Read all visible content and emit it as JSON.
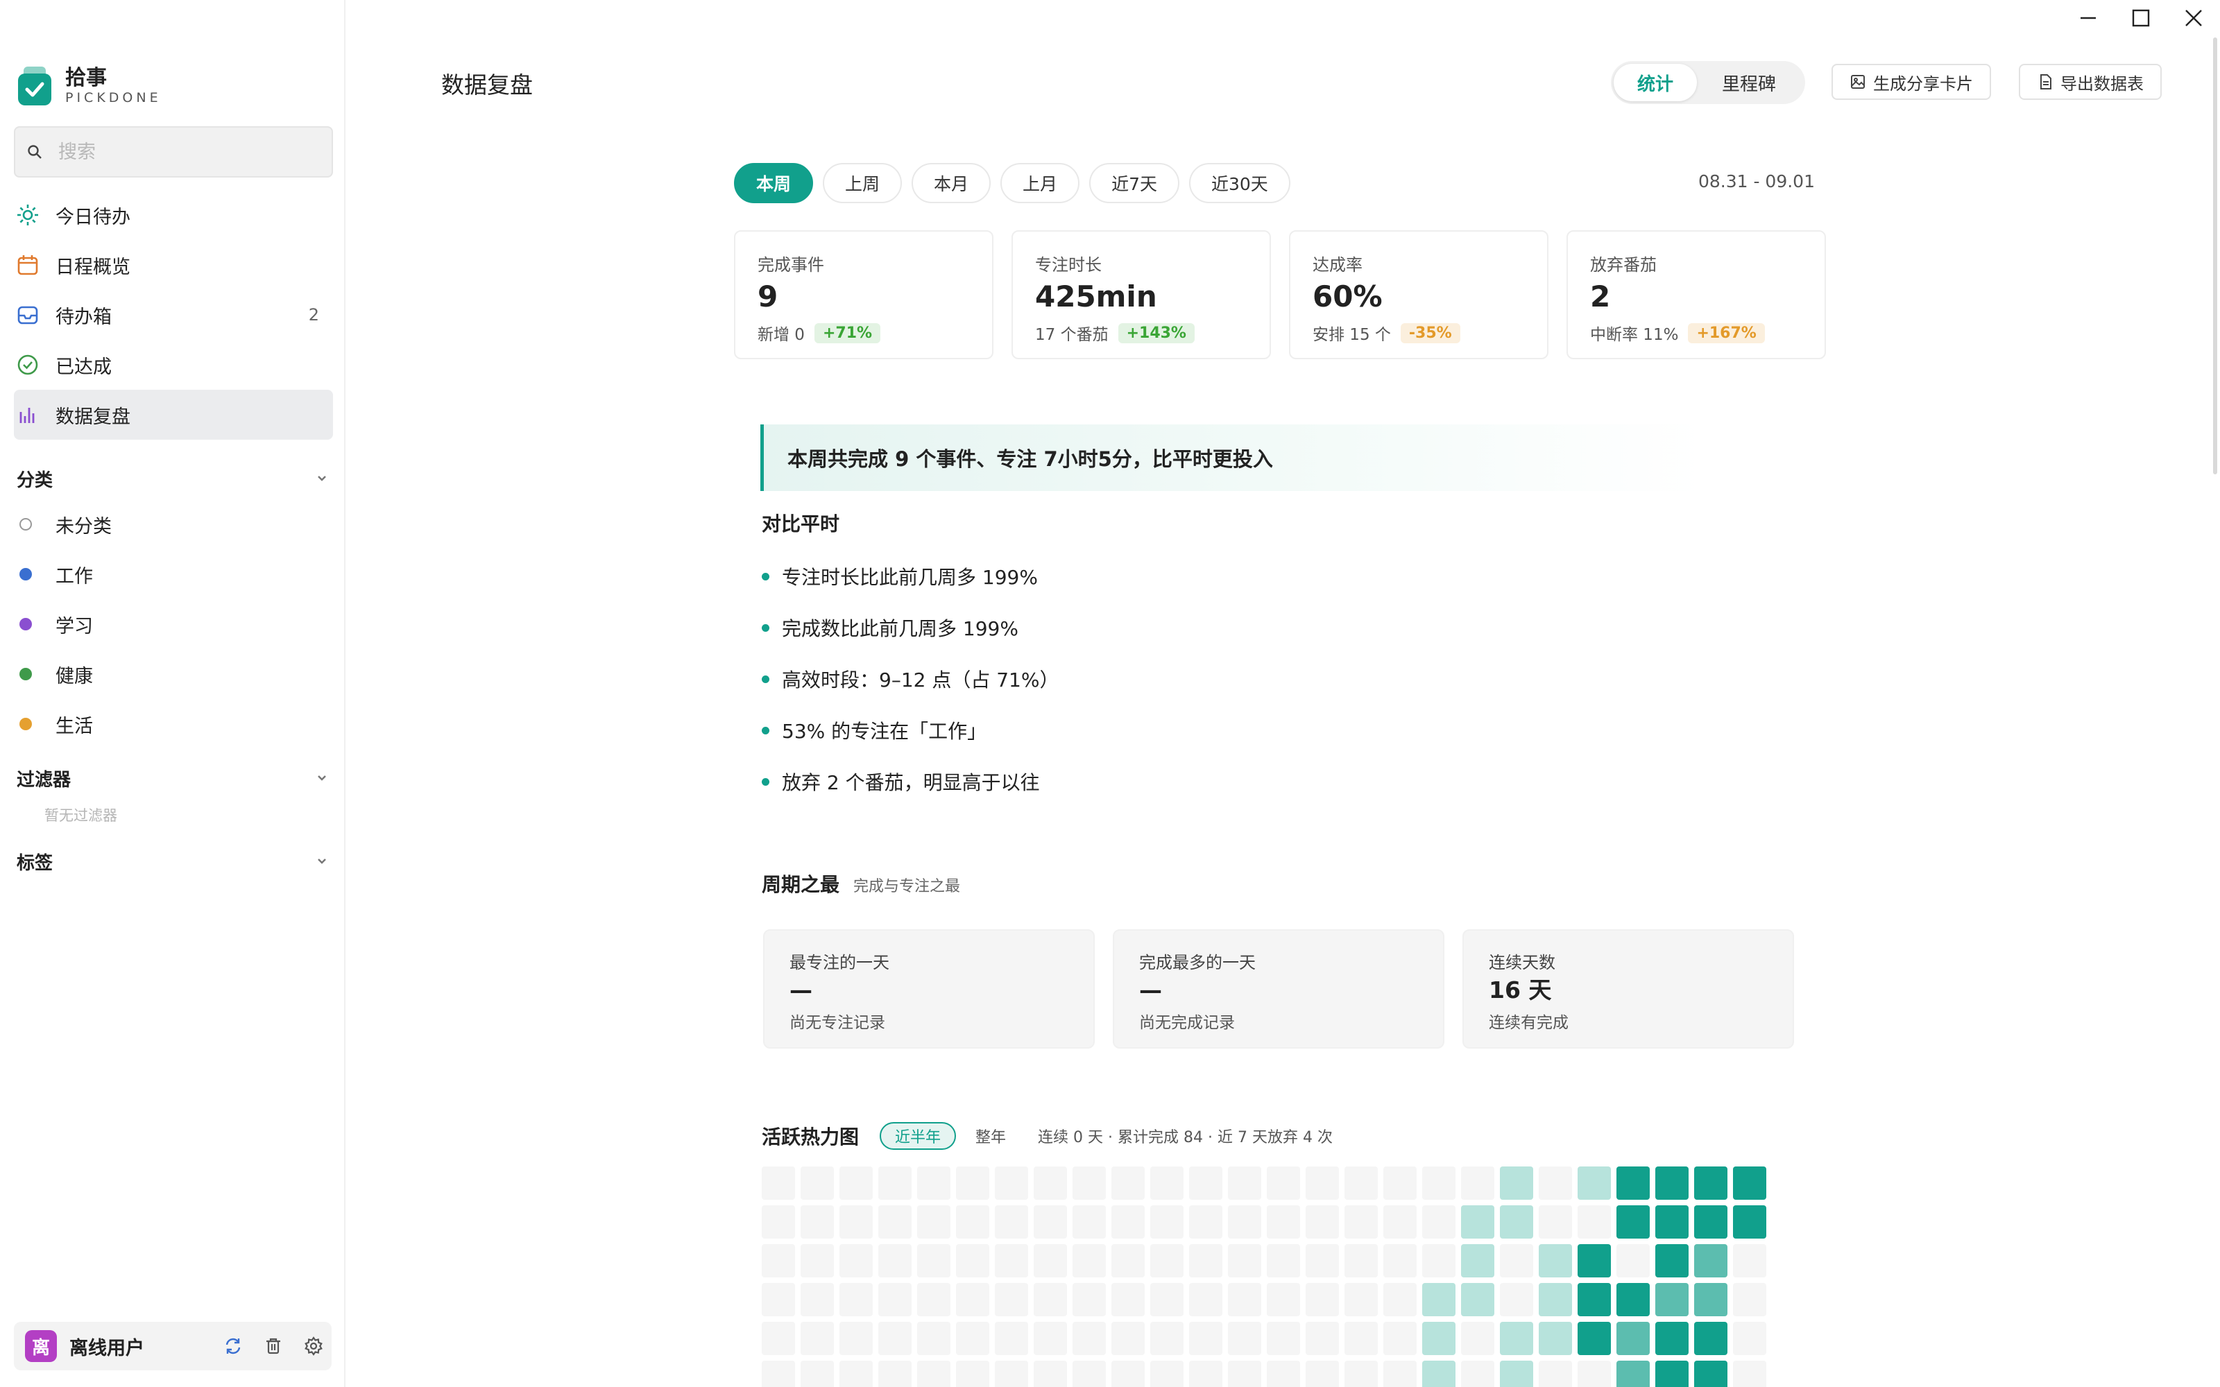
{
  "brand": {
    "name": "拾事",
    "sub": "PICKDONE"
  },
  "search": {
    "placeholder": "搜索"
  },
  "nav": [
    {
      "label": "今日待办",
      "icon": "sun-icon",
      "count": ""
    },
    {
      "label": "日程概览",
      "icon": "calendar-icon",
      "count": ""
    },
    {
      "label": "待办箱",
      "icon": "inbox-icon",
      "count": "2"
    },
    {
      "label": "已达成",
      "icon": "check-circle-icon",
      "count": ""
    },
    {
      "label": "数据复盘",
      "icon": "bar-chart-icon",
      "count": ""
    }
  ],
  "sections": {
    "categories": "分类",
    "filters": "过滤器",
    "tags": "标签",
    "no_filter": "暂无过滤器"
  },
  "categories": [
    {
      "label": "未分类",
      "color": "#ffffff"
    },
    {
      "label": "工作",
      "color": "#3a6fd0"
    },
    {
      "label": "学习",
      "color": "#8a4fd0"
    },
    {
      "label": "健康",
      "color": "#3f9a4a"
    },
    {
      "label": "生活",
      "color": "#e5a030"
    }
  ],
  "user": {
    "name": "离线用户",
    "avatar": "离"
  },
  "page": {
    "title": "数据复盘"
  },
  "view_toggle": {
    "stats": "统计",
    "milestones": "里程碑"
  },
  "actions": {
    "share": "生成分享卡片",
    "export": "导出数据表"
  },
  "ranges": [
    "本周",
    "上周",
    "本月",
    "上月",
    "近7天",
    "近30天"
  ],
  "date_range": "08.31 - 09.01",
  "stats": [
    {
      "label": "完成事件",
      "value": "9",
      "sub": "新增 0",
      "delta": "+71%",
      "tone": "g"
    },
    {
      "label": "专注时长",
      "value": "425min",
      "sub": "17 个番茄",
      "delta": "+143%",
      "tone": "g"
    },
    {
      "label": "达成率",
      "value": "60%",
      "sub": "安排 15 个",
      "delta": "-35%",
      "tone": "o"
    },
    {
      "label": "放弃番茄",
      "value": "2",
      "sub": "中断率 11%",
      "delta": "+167%",
      "tone": "o"
    }
  ],
  "summary": "本周共完成 9 个事件、专注 7小时5分，比平时更投入",
  "compare": {
    "title": "对比平时",
    "items": [
      "专注时长比此前几周多 199%",
      "完成数比此前几周多 199%",
      "高效时段：9–12 点（占 71%）",
      "53% 的专注在「工作」",
      "放弃 2 个番茄，明显高于以往"
    ]
  },
  "best": {
    "title": "周期之最",
    "subtitle": "完成与专注之最",
    "cards": [
      {
        "label": "最专注的一天",
        "value": "—",
        "sub": "尚无专注记录"
      },
      {
        "label": "完成最多的一天",
        "value": "—",
        "sub": "尚无完成记录"
      },
      {
        "label": "连续天数",
        "value": "16 天",
        "sub": "连续有完成"
      }
    ]
  },
  "heatmap": {
    "title": "活跃热力图",
    "tab_active": "近半年",
    "tab_other": "整年",
    "meta": "连续 0 天 · 累计完成 84 · 近 7 天放弃 4 次",
    "colors": [
      "#f5f5f5",
      "#b7e3dc",
      "#5cbdaf",
      "#11a08c"
    ],
    "rows": [
      [
        0,
        0,
        0,
        0,
        0,
        0,
        0,
        0,
        0,
        0,
        0,
        0,
        0,
        0,
        0,
        0,
        0,
        0,
        0,
        1,
        0,
        1,
        3,
        3,
        3,
        3
      ],
      [
        0,
        0,
        0,
        0,
        0,
        0,
        0,
        0,
        0,
        0,
        0,
        0,
        0,
        0,
        0,
        0,
        0,
        0,
        1,
        1,
        0,
        0,
        3,
        3,
        3,
        3
      ],
      [
        0,
        0,
        0,
        0,
        0,
        0,
        0,
        0,
        0,
        0,
        0,
        0,
        0,
        0,
        0,
        0,
        0,
        0,
        1,
        0,
        1,
        3,
        0,
        3,
        2,
        0
      ],
      [
        0,
        0,
        0,
        0,
        0,
        0,
        0,
        0,
        0,
        0,
        0,
        0,
        0,
        0,
        0,
        0,
        0,
        1,
        1,
        0,
        1,
        3,
        3,
        2,
        2,
        0
      ],
      [
        0,
        0,
        0,
        0,
        0,
        0,
        0,
        0,
        0,
        0,
        0,
        0,
        0,
        0,
        0,
        0,
        0,
        1,
        0,
        1,
        1,
        3,
        2,
        3,
        3,
        0
      ],
      [
        0,
        0,
        0,
        0,
        0,
        0,
        0,
        0,
        0,
        0,
        0,
        0,
        0,
        0,
        0,
        0,
        0,
        1,
        0,
        1,
        0,
        0,
        2,
        3,
        3,
        0
      ]
    ]
  }
}
